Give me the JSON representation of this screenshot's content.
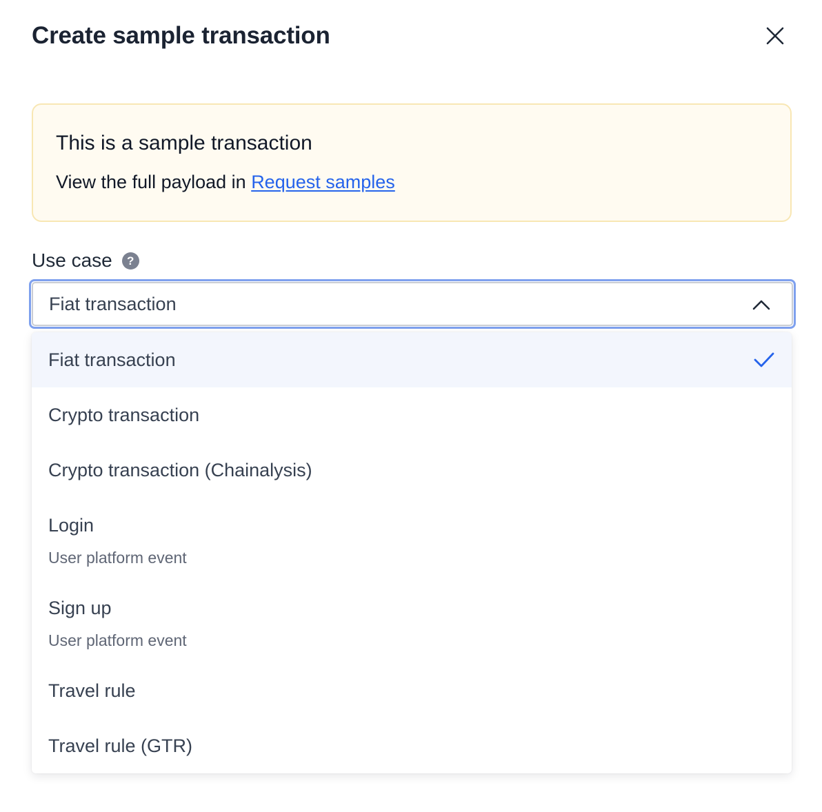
{
  "modal": {
    "title": "Create sample transaction"
  },
  "notice": {
    "title": "This is a sample transaction",
    "text_prefix": "View the full payload in ",
    "link_label": "Request samples"
  },
  "field": {
    "label": "Use case",
    "help_icon": "question-circle-icon",
    "selected_value": "Fiat transaction",
    "state": "open"
  },
  "options": [
    {
      "label": "Fiat transaction",
      "sub": "",
      "selected": true
    },
    {
      "label": "Crypto transaction",
      "sub": "",
      "selected": false
    },
    {
      "label": "Crypto transaction (Chainalysis)",
      "sub": "",
      "selected": false
    },
    {
      "label": "Login",
      "sub": "User platform event",
      "selected": false
    },
    {
      "label": "Sign up",
      "sub": "User platform event",
      "selected": false
    },
    {
      "label": "Travel rule",
      "sub": "",
      "selected": false
    },
    {
      "label": "Travel rule (GTR)",
      "sub": "",
      "selected": false
    }
  ],
  "icons": {
    "close": "close-icon",
    "chevron": "chevron-up-icon",
    "check": "check-icon"
  },
  "colors": {
    "accent": "#2563eb",
    "focus_ring": "#7ea0ee",
    "notice_bg": "#fffbf1",
    "notice_border": "#f8e7b4",
    "selected_bg": "#f3f6fd"
  }
}
